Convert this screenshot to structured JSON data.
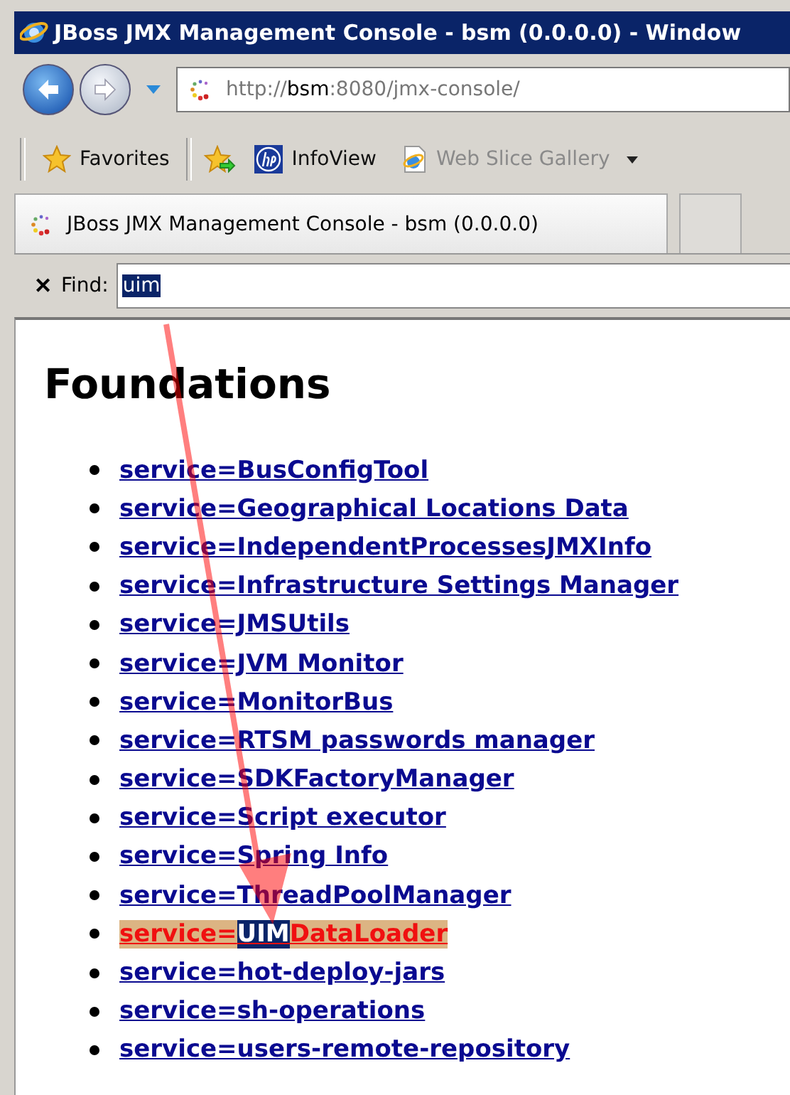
{
  "window": {
    "title": "JBoss JMX Management Console - bsm (0.0.0.0) - Window"
  },
  "address_bar": {
    "url_plain": "http://",
    "url_host": "bsm",
    "url_rest": ":8080/jmx-console/"
  },
  "favorites_bar": {
    "items": [
      {
        "label": "Favorites",
        "kind": "favorites"
      },
      {
        "label": "InfoView",
        "kind": "hp"
      },
      {
        "label": "Web Slice Gallery",
        "kind": "webslice"
      }
    ]
  },
  "tab": {
    "title": "JBoss JMX Management Console - bsm (0.0.0.0)"
  },
  "find_bar": {
    "close": "✕",
    "label": "Find:",
    "value": "uim"
  },
  "page": {
    "heading": "Foundations",
    "links": [
      {
        "label": "service=BusConfigTool",
        "found": false
      },
      {
        "label": "service=Geographical Locations Data",
        "found": false
      },
      {
        "label": "service=IndependentProcessesJMXInfo",
        "found": false
      },
      {
        "label": "service=Infrastructure Settings Manager",
        "found": false
      },
      {
        "label": "service=JMSUtils",
        "found": false
      },
      {
        "label": "service=JVM Monitor",
        "found": false
      },
      {
        "label": "service=MonitorBus",
        "found": false
      },
      {
        "label": "service=RTSM passwords manager",
        "found": false
      },
      {
        "label": "service=SDKFactoryManager",
        "found": false
      },
      {
        "label": "service=Script executor",
        "found": false
      },
      {
        "label": "service=Spring Info",
        "found": false
      },
      {
        "label": "service=ThreadPoolManager",
        "found": false
      },
      {
        "before": "service=",
        "match": "UIM",
        "after": "DataLoader",
        "found": true
      },
      {
        "label": "service=hot-deploy-jars",
        "found": false
      },
      {
        "label": "service=sh-operations",
        "found": false
      },
      {
        "label": "service=users-remote-repository",
        "found": false
      }
    ]
  },
  "annotations": [
    {
      "kind": "arrow"
    }
  ]
}
